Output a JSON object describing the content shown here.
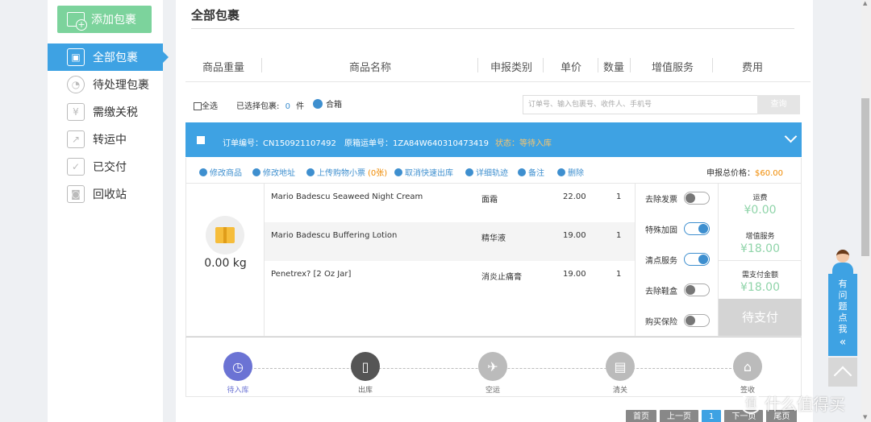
{
  "sidebar": {
    "add_button": "添加包裹",
    "items": [
      {
        "label": "全部包裹",
        "icon": "package-icon"
      },
      {
        "label": "待处理包裹",
        "icon": "clock-icon"
      },
      {
        "label": "需缴关税",
        "icon": "yen-icon"
      },
      {
        "label": "转运中",
        "icon": "transit-icon"
      },
      {
        "label": "已交付",
        "icon": "check-icon"
      },
      {
        "label": "回收站",
        "icon": "camera-icon"
      }
    ]
  },
  "main": {
    "title": "全部包裹",
    "columns": [
      "商品重量",
      "商品名称",
      "申报类别",
      "单价",
      "数量",
      "增值服务",
      "费用"
    ],
    "toolbar": {
      "select_all": "全选",
      "selected_label": "已选择包裹:",
      "selected_count": "0",
      "selected_unit": "件",
      "merge": "合箱",
      "search_placeholder": "订单号、输入包裹号、收件人、手机号",
      "search_button": "查询"
    },
    "order": {
      "order_no": "订单编号：CN150921107492",
      "tracking_no": "原箱运单号：1ZA84W640310473419",
      "status": "状态：等待入库"
    },
    "actions": [
      "修改商品",
      "修改地址",
      "上传购物小票",
      "取消快速出库",
      "详细轨迹",
      "备注",
      "删除"
    ],
    "receipt_count": "(0张)",
    "declared_label": "申报总价格：",
    "declared_value": "$60.00",
    "weight": "0.00 kg",
    "items": [
      {
        "name": "Mario Badescu Seaweed Night Cream",
        "category": "面霜",
        "price": "22.00",
        "qty": "1"
      },
      {
        "name": "Mario Badescu Buffering Lotion",
        "category": "精华液",
        "price": "19.00",
        "qty": "1"
      },
      {
        "name": "Penetrex? [2 Oz Jar]",
        "category": "消炎止痛膏",
        "price": "19.00",
        "qty": "1"
      }
    ],
    "services": [
      {
        "label": "去除发票",
        "on": false
      },
      {
        "label": "特殊加固",
        "on": true
      },
      {
        "label": "清点服务",
        "on": true
      },
      {
        "label": "去除鞋盒",
        "on": false
      },
      {
        "label": "购买保险",
        "on": false
      }
    ],
    "fees": {
      "shipping_label": "运费",
      "shipping_value": "¥0.00",
      "vas_label": "增值服务",
      "vas_value": "¥18.00",
      "due_label": "需支付金额",
      "due_value": "¥18.00",
      "pay_button": "待支付"
    },
    "steps": [
      "待入库",
      "出库",
      "空运",
      "清关",
      "签收"
    ],
    "pager": [
      "首页",
      "上一页",
      "1",
      "下一页",
      "尾页"
    ]
  },
  "help": {
    "label": "有问题点我",
    "arrows": "«"
  },
  "watermark": "什么值得买"
}
